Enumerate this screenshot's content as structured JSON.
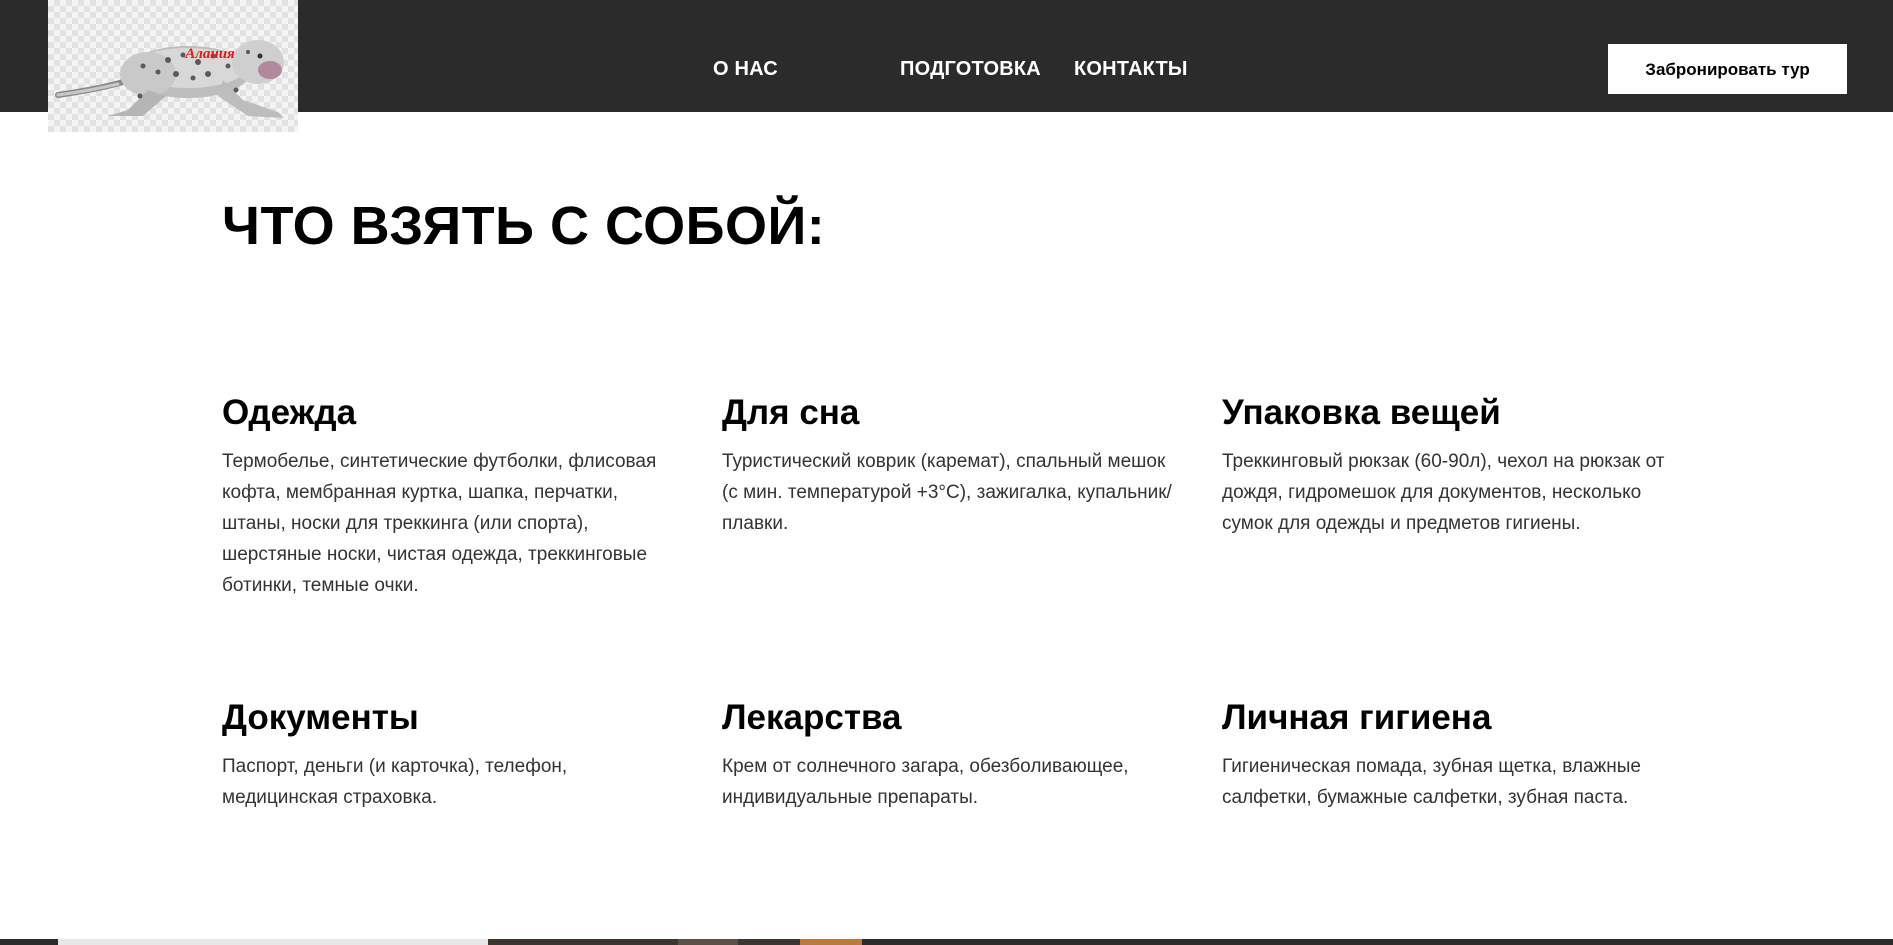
{
  "header": {
    "logo_text": "Алания",
    "nav": [
      {
        "label": "О НАС"
      },
      {
        "label": "ПОДГОТОВКА"
      },
      {
        "label": "КОНТАКТЫ"
      }
    ],
    "book_button": "Забронировать тур"
  },
  "main": {
    "title": "ЧТО ВЗЯТЬ С СОБОЙ:",
    "cards": [
      {
        "title": "Одежда",
        "text": "Термобелье, синтетические футболки, флисовая кофта, мембранная куртка, шапка, перчатки, штаны, носки для треккинга (или спорта), шерстяные носки, чистая одежда, треккинговые ботинки, темные очки."
      },
      {
        "title": "Для сна",
        "text": "Туристический коврик (каремат), спальный мешок (с мин. температурой +3°С), зажигалка, купальник/плавки."
      },
      {
        "title": "Упаковка вещей",
        "text": "Треккинговый рюкзак (60-90л), чехол на рюкзак от дождя, гидромешок для документов, несколько сумок для одежды и предметов гигиены."
      },
      {
        "title": "Документы",
        "text": "Паспорт, деньги (и карточка), телефон, медицинская страховка."
      },
      {
        "title": "Лекарства",
        "text": "Крем от солнечного загара, обезболивающее, индивидуальные препараты."
      },
      {
        "title": "Личная гигиена",
        "text": "Гигиеническая помада, зубная щетка, влажные салфетки, бумажные салфетки, зубная паста."
      }
    ]
  },
  "colors": {
    "header_bg": "#2b2b2b",
    "text": "#000000",
    "body_text": "#333333",
    "button_bg": "#ffffff"
  }
}
